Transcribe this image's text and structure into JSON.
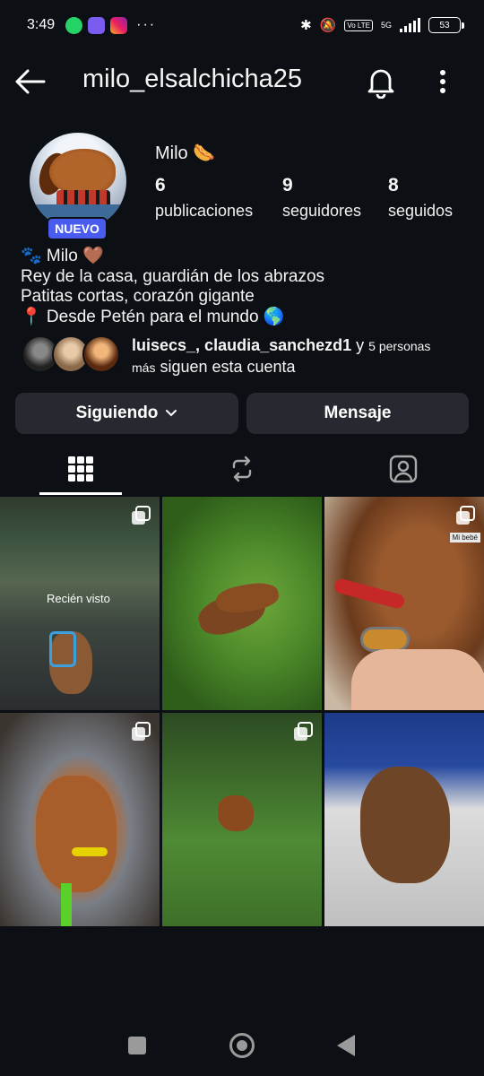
{
  "status_bar": {
    "time": "3:49",
    "more": "···",
    "volte": "Vo LTE",
    "network": "5G",
    "battery": "53"
  },
  "header": {
    "username": "milo_elsalchicha25"
  },
  "profile": {
    "display_name": "Milo 🌭",
    "badge": "NUEVO",
    "stats": [
      {
        "value": "6",
        "label": "publicaciones"
      },
      {
        "value": "9",
        "label": "seguidores"
      },
      {
        "value": "8",
        "label": "seguidos"
      }
    ],
    "bio": [
      "🐾 Milo 🤎",
      "Rey de la casa, guardián de los abrazos",
      "Patitas cortas, corazón gigante",
      "📍 Desde Petén para el mundo 🌎"
    ],
    "mutuals": {
      "names": "luisecs_, claudia_sanchezd1",
      "connector": " y ",
      "count": "5 personas",
      "more": " más",
      "suffix": " siguen esta cuenta"
    }
  },
  "actions": {
    "following_label": "Siguiendo",
    "message_label": "Mensaje"
  },
  "grid": {
    "recent_label": "Recién visto",
    "tag_text": "Mi bebé"
  },
  "colors": {
    "background": "#0c1014",
    "button": "#262a30",
    "badge": "#4a5cf0"
  }
}
